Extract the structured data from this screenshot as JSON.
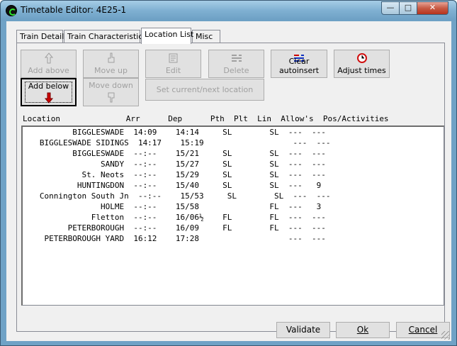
{
  "window": {
    "title": "Timetable Editor: 4E25-1"
  },
  "titlebar": {
    "min": "—",
    "max": "□",
    "close": "✕"
  },
  "tabs": [
    {
      "label": "Train Details",
      "active": false
    },
    {
      "label": "Train Characteristics",
      "active": false
    },
    {
      "label": "Location List",
      "active": true
    },
    {
      "label": "Misc",
      "active": false
    }
  ],
  "toolbar": {
    "add_above": "Add above",
    "move_up": "Move up",
    "edit": "Edit",
    "delete": "Delete",
    "clear_autoinsert": "Clear autoinsert",
    "adjust_times": "Adjust times",
    "add_below": "Add below",
    "move_down": "Move down",
    "set_current_next": "Set current/next location"
  },
  "icons": {
    "add_above": "arrow-up-outline-icon",
    "move_up": "hand-up-icon",
    "edit": "edit-document-icon",
    "delete": "delete-row-icon",
    "clear_autoinsert": "clear-autoinsert-icon",
    "adjust_times": "clock-icon",
    "add_below": "arrow-down-red-icon",
    "move_down": "hand-down-icon"
  },
  "colors": {
    "disabled_text": "#a0a0a0",
    "clock_red": "#d01010",
    "arrow_red": "#cc0000"
  },
  "table": {
    "header": "Location              Arr      Dep      Pth  Plt  Lin  Allow's  Pos/Activities",
    "rows": [
      "          BIGGLESWADE  14:09    14:14     SL        SL  ---  ---",
      "   BIGGLESWADE SIDINGS  14:17    15:19                   ---  ---",
      "          BIGGLESWADE  --:--    15/21     SL        SL  ---  ---",
      "                SANDY  --:--    15/27     SL        SL  ---  ---",
      "            St. Neots  --:--    15/29     SL        SL  ---  ---",
      "           HUNTINGDON  --:--    15/40     SL        SL  ---   9",
      "   Connington South Jn  --:--    15/53     SL        SL  ---  ---",
      "                HOLME  --:--    15/58               FL  ---   3",
      "              Fletton  --:--    16/06½    FL        FL  ---  ---",
      "         PETERBOROUGH  --:--    16/09     FL        FL  ---  ---",
      "    PETERBOROUGH YARD  16:12    17:28                   ---  ---"
    ]
  },
  "bottom": {
    "validate": "Validate",
    "ok": "Ok",
    "cancel": "Cancel"
  }
}
